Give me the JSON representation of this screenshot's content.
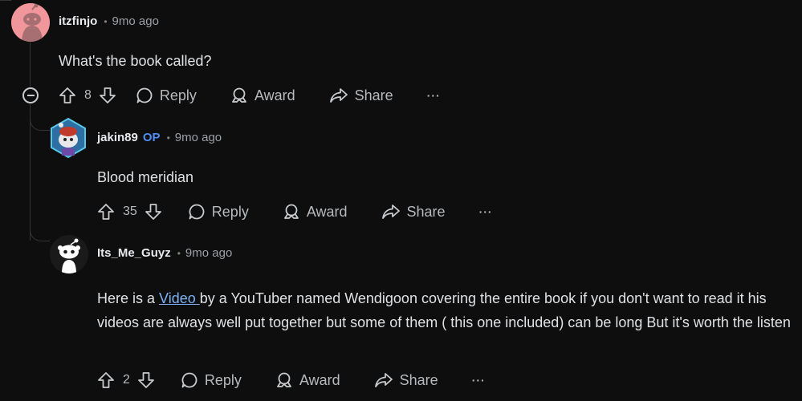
{
  "colors": {
    "background": "#0e0e0f",
    "link": "#7cb2f5",
    "op_badge": "#4f8ff7",
    "thread_line": "#343536"
  },
  "comments": [
    {
      "username": "itzfinjo",
      "time": "9mo ago",
      "body": "What's the book called?",
      "votes": "8",
      "actions": {
        "reply": "Reply",
        "award": "Award",
        "share": "Share",
        "more": "···"
      },
      "avatar_icon": "reddit-pink-snoo-avatar"
    },
    {
      "username": "jakin89",
      "op_badge": "OP",
      "time": "9mo ago",
      "body": "Blood meridian",
      "votes": "35",
      "actions": {
        "reply": "Reply",
        "award": "Award",
        "share": "Share",
        "more": "···"
      },
      "avatar_icon": "snoo-hexagon-avatar"
    },
    {
      "username": "Its_Me_Guyz",
      "time": "9mo ago",
      "body_pre": "Here is a ",
      "body_link": "Video ",
      "body_post": "by a YouTuber named Wendigoon covering the entire book if you don't want to read it his videos are always well put together but some of them ( this one included) can be long But it's worth the listen",
      "votes": "2",
      "actions": {
        "reply": "Reply",
        "award": "Award",
        "share": "Share",
        "more": "···"
      },
      "avatar_icon": "default-snoo-avatar"
    }
  ]
}
